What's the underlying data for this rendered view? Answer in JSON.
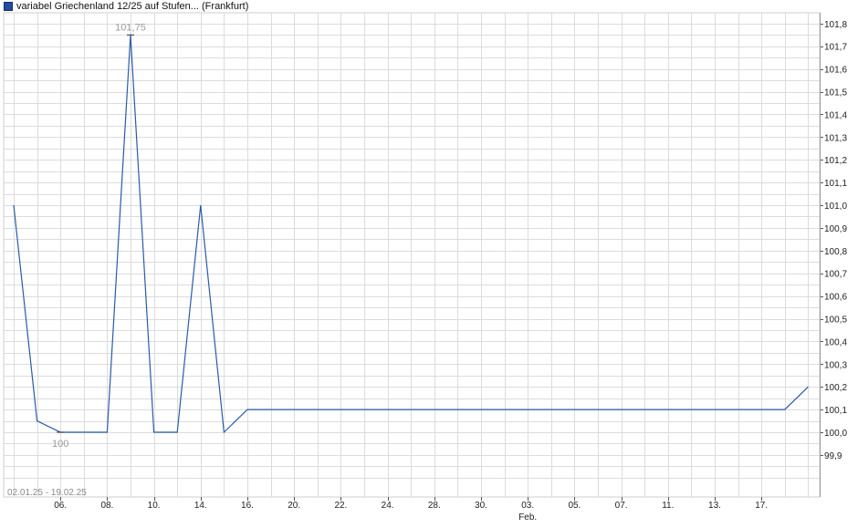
{
  "chart_data": {
    "type": "line",
    "series": [
      {
        "name": "variabel Griechenland 12/25 auf Stufen... (Frankfurt)",
        "color": "#2a5ba8",
        "values": [
          101.0,
          100.05,
          100.0,
          100.0,
          100.0,
          101.75,
          100.0,
          100.0,
          101.0,
          100.0,
          100.1,
          100.1,
          100.1,
          100.1,
          100.1,
          100.1,
          100.1,
          100.1,
          100.1,
          100.1,
          100.1,
          100.1,
          100.1,
          100.1,
          100.1,
          100.1,
          100.1,
          100.1,
          100.1,
          100.1,
          100.1,
          100.1,
          100.1,
          100.1,
          100.2
        ]
      }
    ],
    "x_ticks": [
      "06.",
      "08.",
      "10.",
      "14.",
      "16.",
      "20.",
      "22.",
      "24.",
      "28.",
      "30.",
      "03.",
      "05.",
      "07.",
      "11.",
      "13.",
      "17."
    ],
    "x_tick_index": [
      2,
      4,
      6,
      8,
      10,
      12,
      14,
      16,
      18,
      20,
      22,
      24,
      26,
      28,
      30,
      32
    ],
    "x_month_label": "Feb.",
    "x_month_tick": "03.",
    "y_ticks": [
      "101,8",
      "101,7",
      "101,6",
      "101,5",
      "101,4",
      "101,3",
      "101,2",
      "101,1",
      "101,0",
      "100,9",
      "100,8",
      "100,7",
      "100,6",
      "100,5",
      "100,4",
      "100,3",
      "100,2",
      "100,1",
      "100,0",
      "99,9"
    ],
    "ylim": [
      99.8,
      101.85
    ],
    "y_axis_position": "right",
    "grid": true,
    "legend_position": "top-left",
    "annotations": {
      "max_label": "101,75",
      "min_label": "100"
    },
    "date_range": "02.01.25 - 19.02.25",
    "colors": {
      "grid": "#dcdcdc",
      "line": "#2a5ba8",
      "legend_swatch": "#1f4e9c",
      "annotation": "#9a9a9a"
    }
  }
}
